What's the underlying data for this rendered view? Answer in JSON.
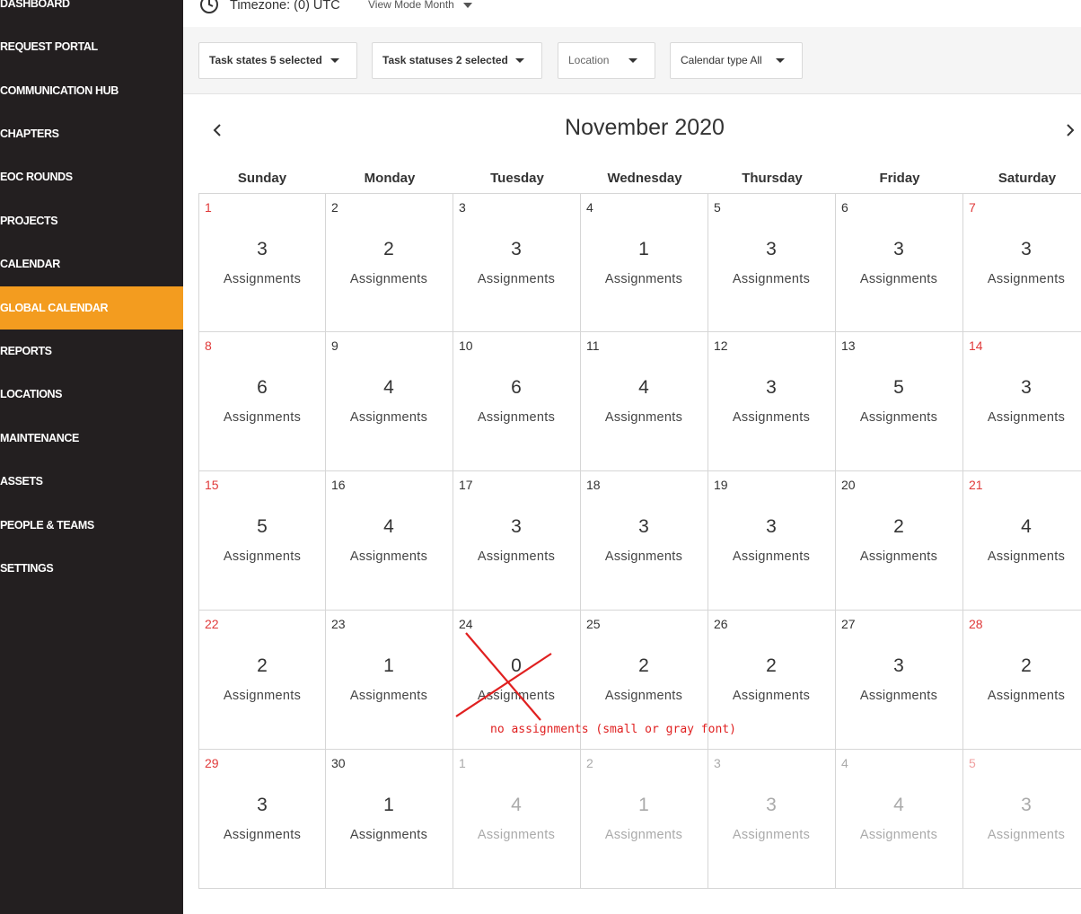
{
  "sidebar": {
    "items": [
      {
        "label": "DASHBOARD"
      },
      {
        "label": "REQUEST PORTAL"
      },
      {
        "label": "COMMUNICATION HUB"
      },
      {
        "label": "CHAPTERS"
      },
      {
        "label": "EOC ROUNDS"
      },
      {
        "label": "PROJECTS"
      },
      {
        "label": "CALENDAR"
      },
      {
        "label": "GLOBAL CALENDAR",
        "active": true
      },
      {
        "label": "REPORTS"
      },
      {
        "label": "LOCATIONS"
      },
      {
        "label": "MAINTENANCE"
      },
      {
        "label": "ASSETS"
      },
      {
        "label": "PEOPLE & TEAMS"
      },
      {
        "label": "SETTINGS"
      }
    ],
    "active_color": "#f39c1f",
    "bg_color": "#231f20"
  },
  "header": {
    "timezone": "Timezone: (0) UTC",
    "view_mode": "View Mode Month",
    "clock_icon": "clock-icon"
  },
  "filters": {
    "task_states": "Task states 5 selected",
    "task_statuses": "Task statuses 2 selected",
    "location": "Location",
    "calendar_type": "Calendar type All"
  },
  "calendar": {
    "title": "November 2020",
    "weekdays": [
      "Sunday",
      "Monday",
      "Tuesday",
      "Wednesday",
      "Thursday",
      "Friday",
      "Saturday"
    ],
    "assignment_label": "Assignments",
    "weeks": [
      [
        {
          "date": "1",
          "count": "3"
        },
        {
          "date": "2",
          "count": "2"
        },
        {
          "date": "3",
          "count": "3"
        },
        {
          "date": "4",
          "count": "1"
        },
        {
          "date": "5",
          "count": "3"
        },
        {
          "date": "6",
          "count": "3"
        },
        {
          "date": "7",
          "count": "3"
        }
      ],
      [
        {
          "date": "8",
          "count": "6"
        },
        {
          "date": "9",
          "count": "4"
        },
        {
          "date": "10",
          "count": "6"
        },
        {
          "date": "11",
          "count": "4"
        },
        {
          "date": "12",
          "count": "3"
        },
        {
          "date": "13",
          "count": "5"
        },
        {
          "date": "14",
          "count": "3"
        }
      ],
      [
        {
          "date": "15",
          "count": "5"
        },
        {
          "date": "16",
          "count": "4"
        },
        {
          "date": "17",
          "count": "3"
        },
        {
          "date": "18",
          "count": "3"
        },
        {
          "date": "19",
          "count": "3"
        },
        {
          "date": "20",
          "count": "2"
        },
        {
          "date": "21",
          "count": "4"
        }
      ],
      [
        {
          "date": "22",
          "count": "2"
        },
        {
          "date": "23",
          "count": "1"
        },
        {
          "date": "24",
          "count": "0"
        },
        {
          "date": "25",
          "count": "2"
        },
        {
          "date": "26",
          "count": "2"
        },
        {
          "date": "27",
          "count": "3"
        },
        {
          "date": "28",
          "count": "2"
        }
      ],
      [
        {
          "date": "29",
          "count": "3"
        },
        {
          "date": "30",
          "count": "1"
        },
        {
          "date": "1",
          "count": "4",
          "other": true
        },
        {
          "date": "2",
          "count": "1",
          "other": true
        },
        {
          "date": "3",
          "count": "3",
          "other": true
        },
        {
          "date": "4",
          "count": "4",
          "other": true
        },
        {
          "date": "5",
          "count": "3",
          "other": true
        }
      ]
    ]
  },
  "annotation": {
    "text": "no assignments (small or gray font)",
    "color": "#e02020"
  }
}
